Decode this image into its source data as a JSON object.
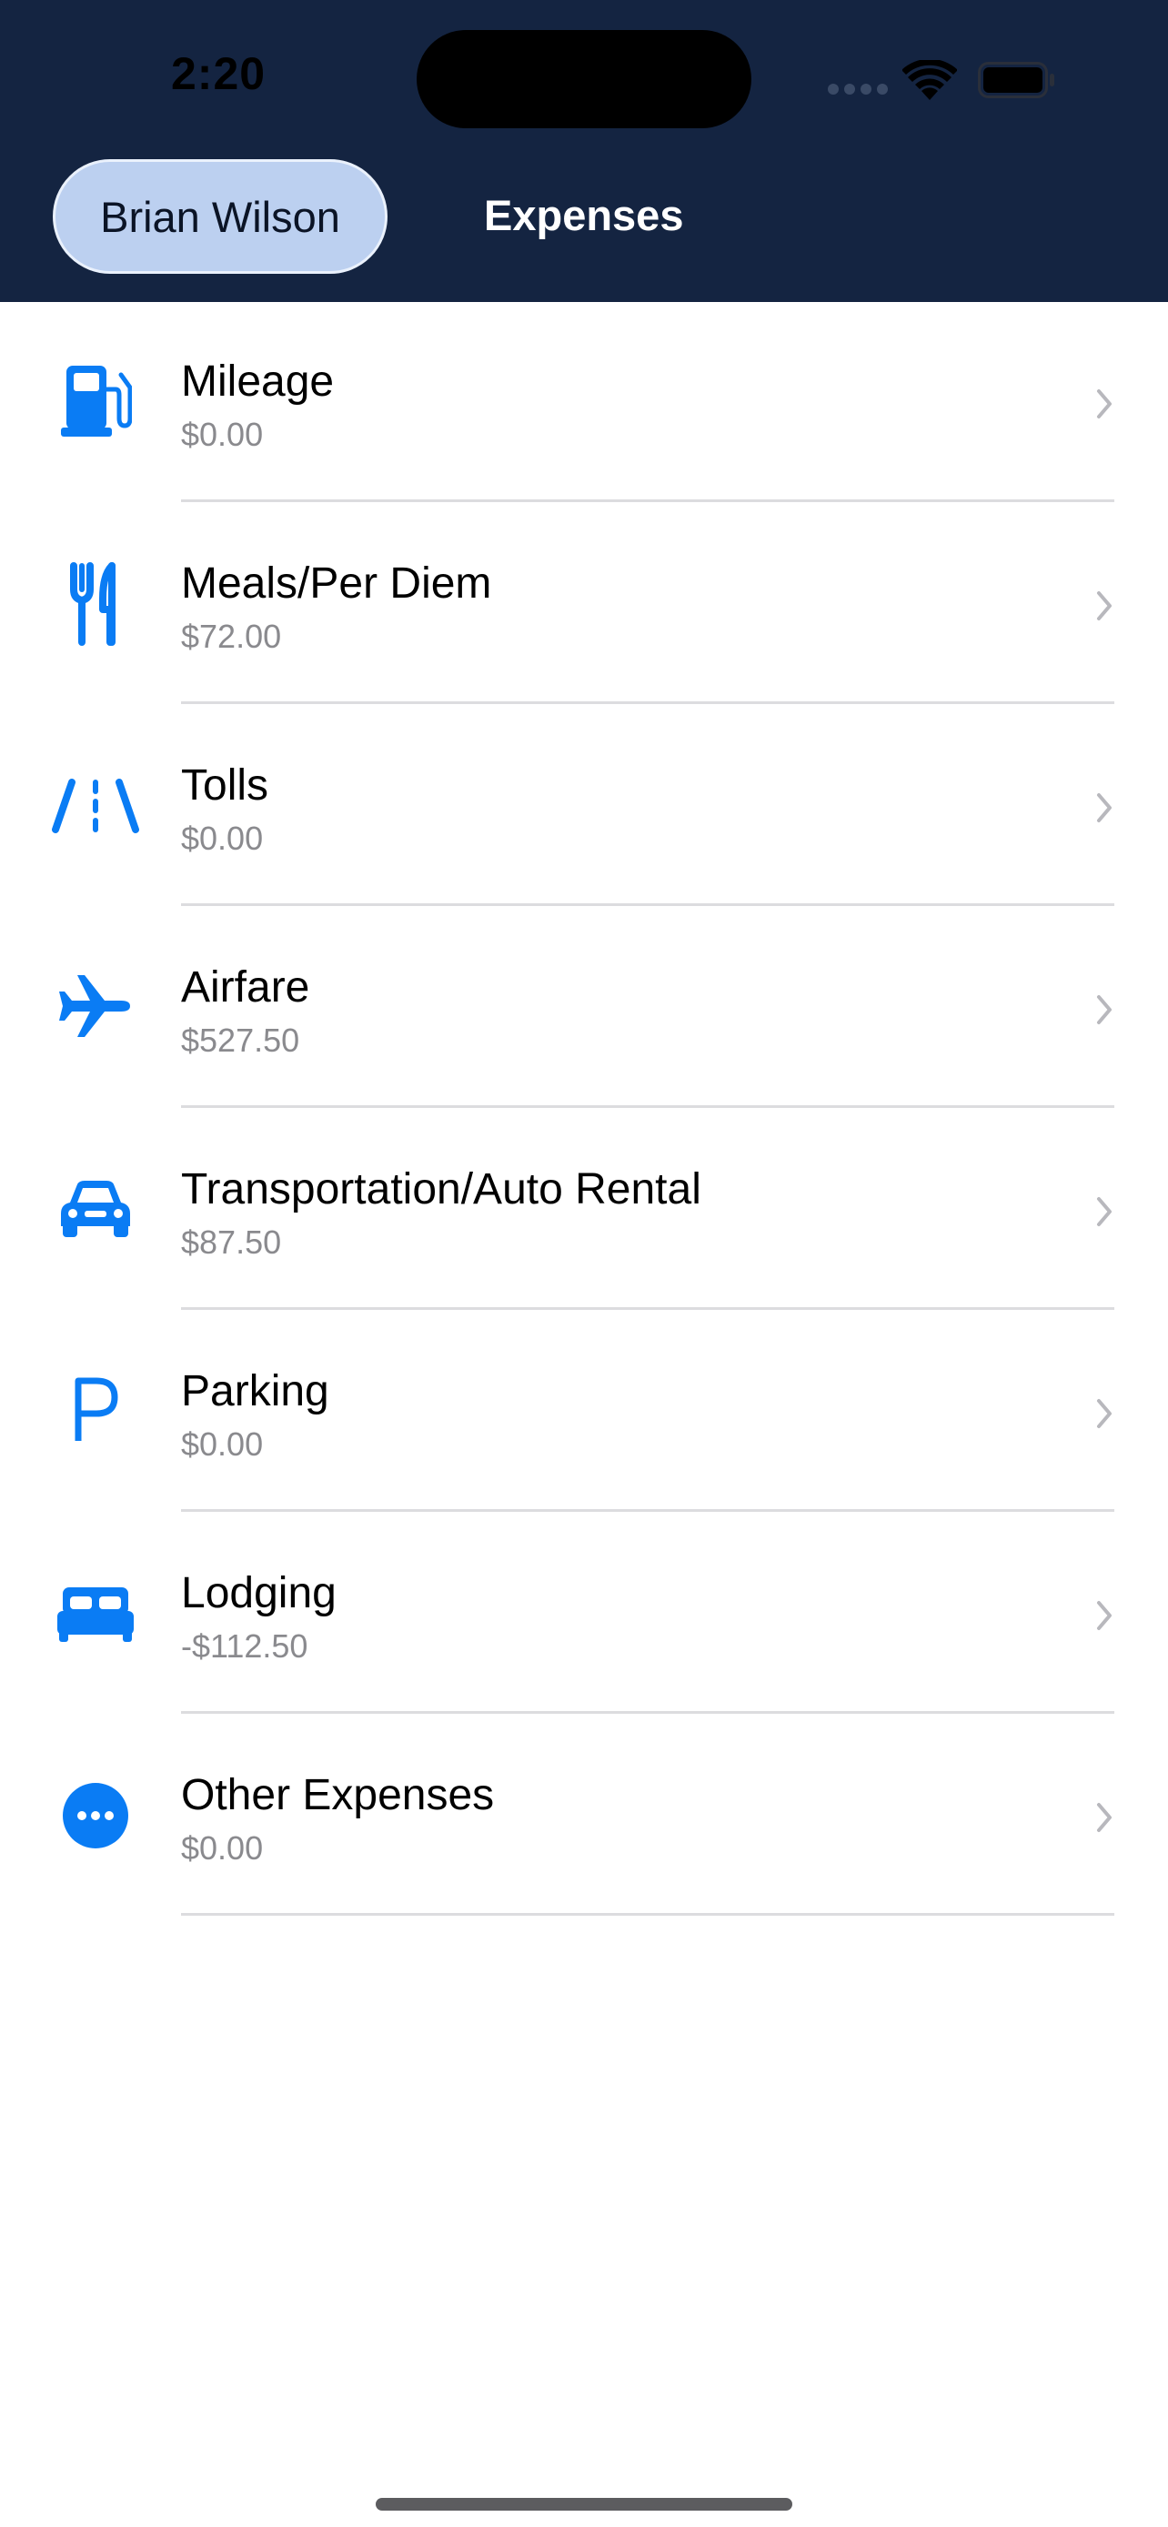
{
  "status_bar": {
    "time": "2:20"
  },
  "nav": {
    "back_label": "Brian Wilson",
    "title": "Expenses"
  },
  "colors": {
    "header_bg": "#142441",
    "accent": "#0a7cf4",
    "pill_bg": "#bcd0f0",
    "secondary_text": "#8a8a8e"
  },
  "expenses": [
    {
      "icon": "fuel-pump-icon",
      "title": "Mileage",
      "amount": "$0.00"
    },
    {
      "icon": "fork-knife-icon",
      "title": "Meals/Per Diem",
      "amount": "$72.00"
    },
    {
      "icon": "road-lanes-icon",
      "title": "Tolls",
      "amount": "$0.00"
    },
    {
      "icon": "airplane-icon",
      "title": "Airfare",
      "amount": "$527.50"
    },
    {
      "icon": "car-icon",
      "title": "Transportation/Auto Rental",
      "amount": "$87.50"
    },
    {
      "icon": "parking-icon",
      "title": "Parking",
      "amount": "$0.00"
    },
    {
      "icon": "bed-icon",
      "title": "Lodging",
      "amount": "-$112.50"
    },
    {
      "icon": "more-ellipsis-icon",
      "title": "Other Expenses",
      "amount": "$0.00"
    }
  ]
}
